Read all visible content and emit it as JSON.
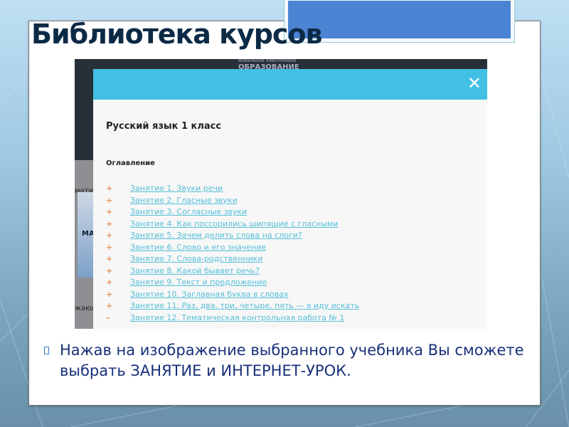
{
  "slide": {
    "title": "Библиотека курсов",
    "bullet": "Нажав на изображение выбранного учебника Вы сможете выбрать ЗАНЯТИЕ и ИНТЕРНЕТ-УРОК."
  },
  "screenshot": {
    "logo_small": "МОБИЛЬНОЕ ЭЛЕКТРОННОЕ",
    "logo": "ОБРАЗОВАНИЕ",
    "background_fragments": [
      "матик",
      "МА",
      "жающ"
    ],
    "modal": {
      "close": "✕",
      "title": "Русский язык 1 класс",
      "toc_heading": "Оглавление",
      "items": [
        {
          "mark": "+",
          "label": "Занятие 1. Звуки речи"
        },
        {
          "mark": "+",
          "label": "Занятие 2. Гласные звуки"
        },
        {
          "mark": "+",
          "label": "Занятие 3. Согласные звуки"
        },
        {
          "mark": "+",
          "label": "Занятие 4. Как поссорились шипящие с гласными"
        },
        {
          "mark": "+",
          "label": "Занятие 5. Зачем делить слова на слоги?"
        },
        {
          "mark": "+",
          "label": "Занятие 6. Слово и его значение"
        },
        {
          "mark": "+",
          "label": "Занятие 7. Слова-родственники"
        },
        {
          "mark": "+",
          "label": "Занятие 8. Какой бывает речь?"
        },
        {
          "mark": "+",
          "label": "Занятие 9. Текст и предложение"
        },
        {
          "mark": "+",
          "label": "Занятие 10. Заглавная буква в словах"
        },
        {
          "mark": "+",
          "label": "Занятие 11. Раз, два, три, четыре, пять — я иду искать"
        },
        {
          "mark": "–",
          "label": "Занятие 12. Тематическая контрольная работа № 1"
        }
      ]
    }
  },
  "colors": {
    "header": "#42c0e4",
    "link": "#55c0d8",
    "title": "#0c2a45"
  }
}
